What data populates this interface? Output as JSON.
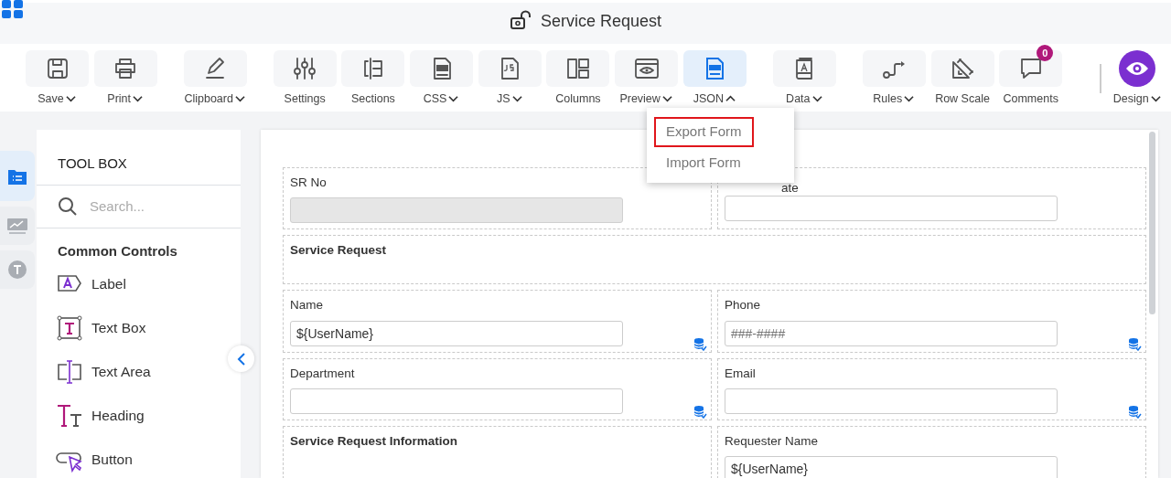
{
  "app": {
    "title": "Service Request"
  },
  "toolbar_groups": [
    {
      "items": [
        {
          "label": "Save",
          "dropdown": true,
          "expanded": false,
          "selected": false
        },
        {
          "label": "Print",
          "dropdown": true,
          "expanded": false,
          "selected": false
        }
      ]
    },
    {
      "items": [
        {
          "label": "Clipboard",
          "dropdown": true,
          "expanded": false,
          "selected": false
        }
      ]
    },
    {
      "items": [
        {
          "label": "Settings",
          "dropdown": false,
          "selected": false
        },
        {
          "label": "Sections",
          "dropdown": false,
          "selected": false
        },
        {
          "label": "CSS",
          "dropdown": true,
          "expanded": false,
          "selected": false
        },
        {
          "label": "JS",
          "dropdown": true,
          "expanded": false,
          "selected": false
        },
        {
          "label": "Columns",
          "dropdown": false,
          "selected": false
        },
        {
          "label": "Preview",
          "dropdown": true,
          "expanded": false,
          "selected": false
        },
        {
          "label": "JSON",
          "dropdown": true,
          "expanded": true,
          "selected": true
        }
      ]
    },
    {
      "items": [
        {
          "label": "Data",
          "dropdown": true,
          "expanded": false,
          "selected": false
        }
      ]
    },
    {
      "items": [
        {
          "label": "Rules",
          "dropdown": true,
          "expanded": false,
          "selected": false
        },
        {
          "label": "Row Scale",
          "dropdown": false,
          "selected": false
        },
        {
          "label": "Comments",
          "dropdown": false,
          "badge": "0",
          "selected": false
        }
      ]
    }
  ],
  "design": {
    "label": "Design",
    "dropdown": true,
    "expanded": false
  },
  "json_menu": [
    {
      "label": "Export Form",
      "highlighted": true
    },
    {
      "label": "Import Form",
      "highlighted": false
    }
  ],
  "rail_tabs": [
    {
      "selected": true
    },
    {
      "selected": false
    },
    {
      "selected": false
    }
  ],
  "toolbox": {
    "title": "TOOL BOX",
    "search": {
      "placeholder": "Search..."
    },
    "section": "Common Controls",
    "items": [
      {
        "label": "Label"
      },
      {
        "label": "Text Box"
      },
      {
        "label": "Text Area"
      },
      {
        "label": "Heading"
      },
      {
        "label": "Button"
      }
    ]
  },
  "form_rows": [
    {
      "cells": [
        {
          "kind": "field",
          "label": "SR No",
          "disabled": true
        },
        {
          "kind": "field",
          "label": "ate",
          "covered": true,
          "disabled": false
        }
      ]
    },
    {
      "cells": [
        {
          "kind": "heading",
          "label": "Service Request",
          "full": true
        }
      ]
    },
    {
      "cells": [
        {
          "kind": "field",
          "label": "Name",
          "value": "${UserName}",
          "disabled": false,
          "bound": true
        },
        {
          "kind": "field",
          "label": "Phone",
          "placeholder": "###-####",
          "disabled": false,
          "bound": true
        }
      ]
    },
    {
      "cells": [
        {
          "kind": "field",
          "label": "Department",
          "disabled": false,
          "bound": true
        },
        {
          "kind": "field",
          "label": "Email",
          "disabled": false,
          "bound": true
        }
      ]
    },
    {
      "cells": [
        {
          "kind": "heading",
          "label": "Service Request Information",
          "full": false
        },
        {
          "kind": "field",
          "label": "Requester Name",
          "value": "${UserName}",
          "disabled": false
        }
      ]
    }
  ]
}
